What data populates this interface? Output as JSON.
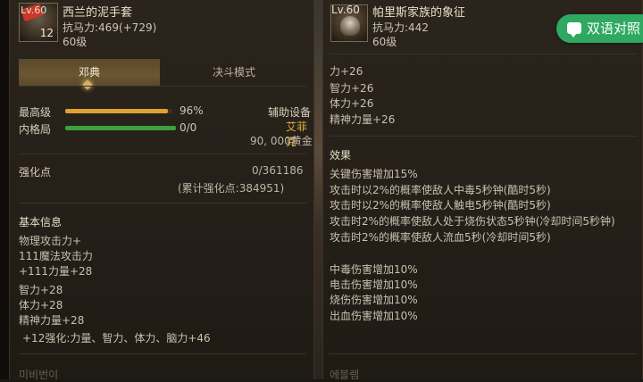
{
  "translate_button": {
    "label": "双语对照"
  },
  "left_item": {
    "icon_lv": "Lv.60",
    "icon_count": "12",
    "name": "西兰的泥手套",
    "resist": "抗马力:469(+729)",
    "level": "60级",
    "tabs": [
      {
        "label": "邓典"
      },
      {
        "label": "决斗模式"
      }
    ],
    "rows": [
      {
        "label": "最高级",
        "value": "96%",
        "fill": 0.96,
        "color": "#e0a030"
      },
      {
        "label": "内格局",
        "value": "0/0",
        "fill": 1.0,
        "color": "#3aa040"
      }
    ],
    "aux": {
      "label": "辅助设备",
      "name": "艾菲克",
      "price": "90, 000黄金"
    },
    "enhance": {
      "label": "强化点",
      "value": "0/361186",
      "total": "(累计强化点:384951)"
    },
    "basic_title": "基本信息",
    "basic_lines": [
      "物理攻击力+",
      "111魔法攻击力",
      "+111力量+28",
      "智力+28",
      "体力+28",
      "精神力量+28"
    ],
    "enhance_line": "+12强化:力量、智力、体力、脑力+46",
    "faded_text": "미비번이"
  },
  "right_item": {
    "icon_lv": "Lv.60",
    "name": "帕里斯家族的象征",
    "resist": "抗马力:442",
    "level": "60级",
    "stats": [
      "力+26",
      "智力+26",
      "体力+26",
      "精神力量+26"
    ],
    "effects_title": "效果",
    "effects": [
      "关键伤害增加15%",
      "攻击时以2%的概率使敌人中毒5秒钟(酷时5秒)",
      "攻击时以2%的概率使敌人触电5秒钟(酷时5秒)",
      "攻击时2%的概率使敌人处于烧伤状态5秒钟(冷却时间5秒钟)",
      "攻击时2%的概率使敌人流血5秒(冷却时间5秒)"
    ],
    "damage_lines": [
      "中毒伤害增加10%",
      "电击伤害增加10%",
      "烧伤伤害增加10%",
      "出血伤害增加10%"
    ],
    "faded_text": "에블렘"
  }
}
